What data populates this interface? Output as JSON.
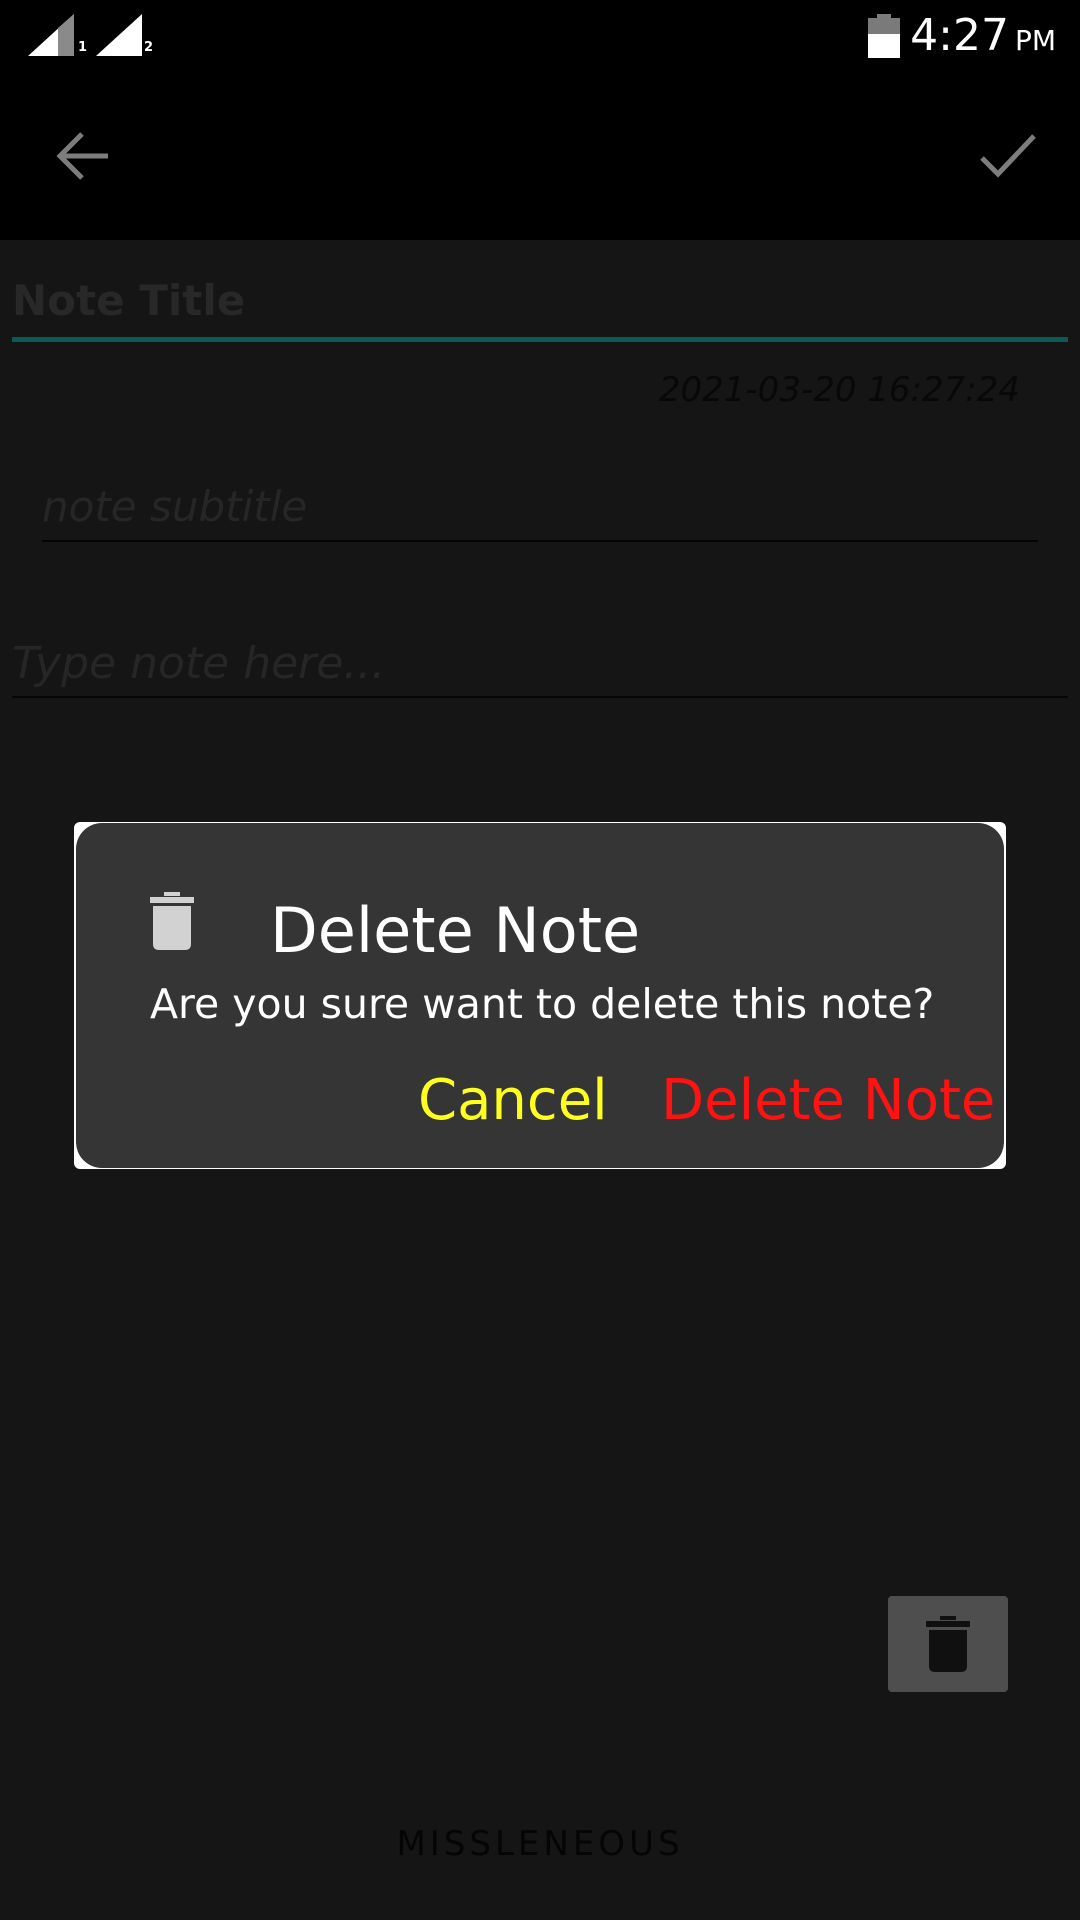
{
  "status_bar": {
    "sim1_label": "1",
    "sim2_label": "2",
    "time": "4:27",
    "ampm": "PM",
    "icons": [
      "signal-icon",
      "signal-icon",
      "battery-icon"
    ]
  },
  "toolbar": {
    "back_icon": "arrow-back-icon",
    "save_icon": "check-icon"
  },
  "note": {
    "title_placeholder": "Note Title",
    "datetime": "2021-03-20  16:27:24",
    "subtitle_placeholder": "note subtitle",
    "body_placeholder": "Type note here..."
  },
  "dialog": {
    "icon": "trash-icon",
    "title": "Delete Note",
    "message": "Are you sure want to delete this note?",
    "cancel_label": "Cancel",
    "delete_label": "Delete Note"
  },
  "fab": {
    "icon": "trash-icon"
  },
  "category": {
    "label": "MISSLENEOUS"
  },
  "colors": {
    "background": "#151515",
    "bars": "#000000",
    "accent": "#0b5a55",
    "dialog": "#353535",
    "cancel": "#ffff1f",
    "delete": "#ff1212"
  }
}
